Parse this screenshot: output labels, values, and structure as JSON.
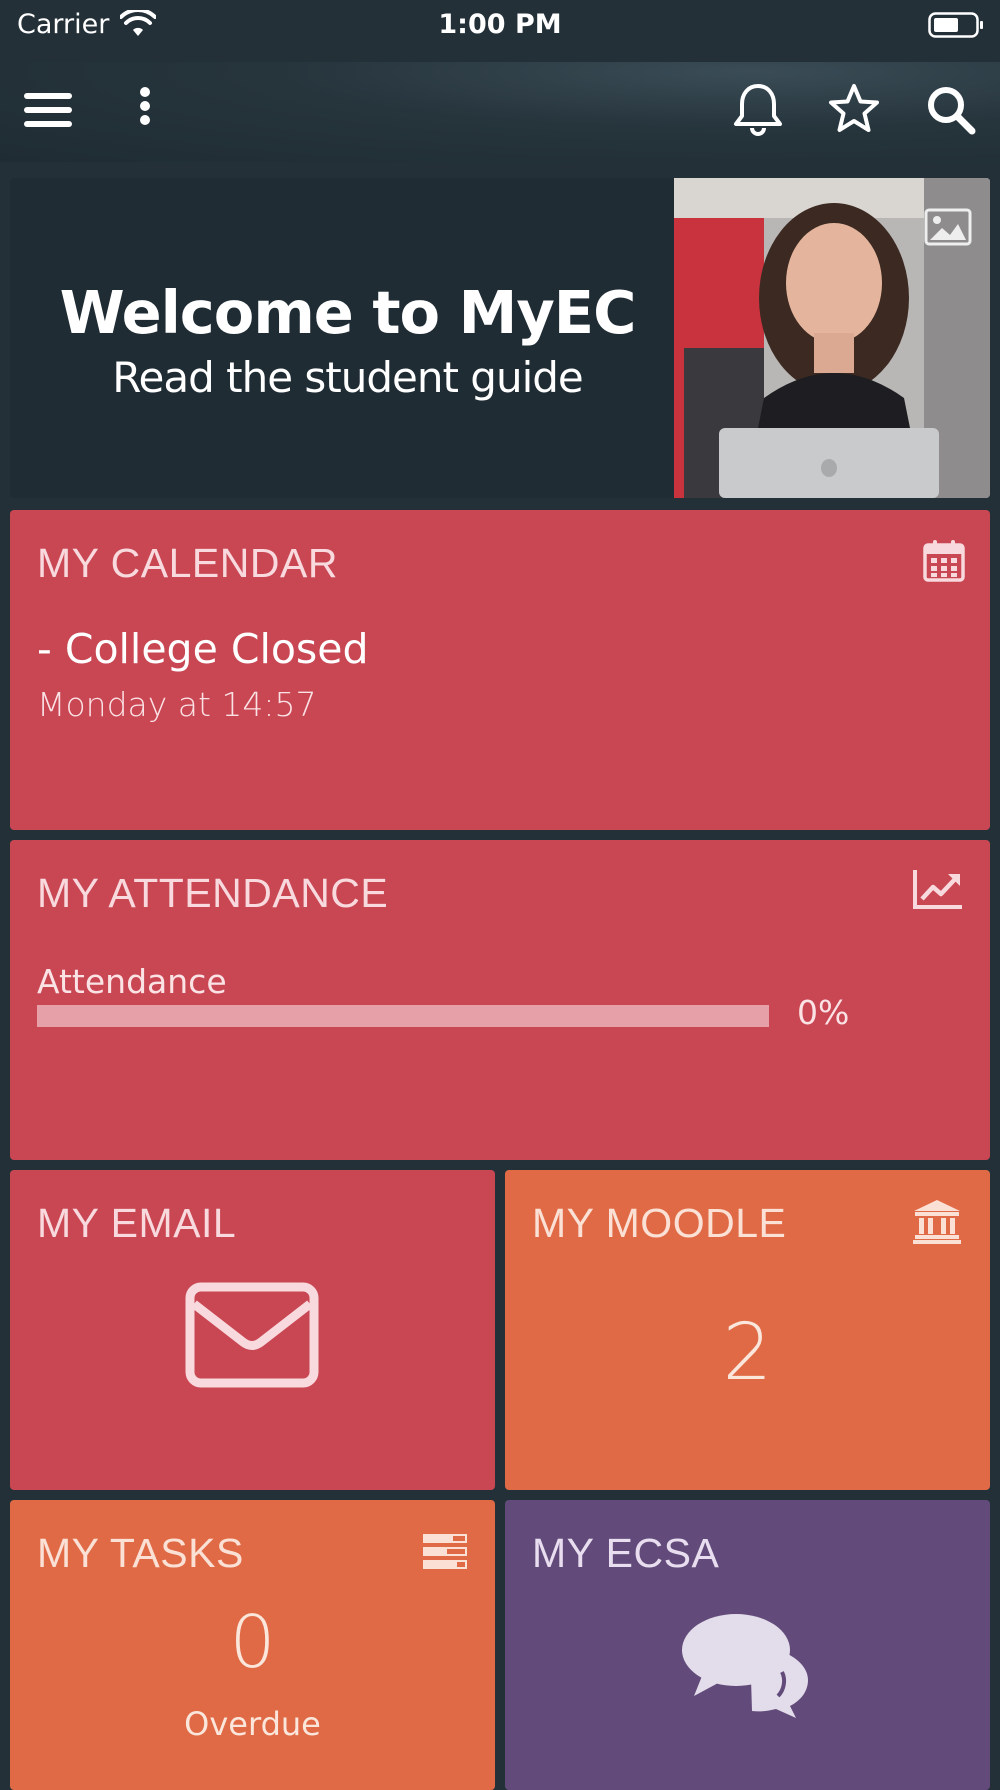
{
  "status_bar": {
    "carrier": "Carrier",
    "time": "1:00 PM"
  },
  "toolbar": {
    "icons": [
      "hamburger-menu-icon",
      "more-vertical-icon",
      "bell-icon",
      "star-icon",
      "search-icon"
    ]
  },
  "banner": {
    "headline": "Welcome to MyEC",
    "subtitle": "Read the student guide",
    "icon": "image-icon"
  },
  "calendar": {
    "title": "MY CALENDAR",
    "icon": "calendar-icon",
    "event_title": "- College Closed",
    "event_time": "Monday at 14:57"
  },
  "attendance": {
    "title": "MY ATTENDANCE",
    "icon": "line-chart-icon",
    "label": "Attendance",
    "percent_text": "0%",
    "percent_value": 0
  },
  "email": {
    "title": "MY EMAIL",
    "icon": "envelope-icon"
  },
  "moodle": {
    "title": "MY MOODLE",
    "icon": "institution-icon",
    "count": "2"
  },
  "tasks": {
    "title": "MY TASKS",
    "icon": "tasks-icon",
    "count": "0",
    "count_label": "Overdue"
  },
  "ecsa": {
    "title": "MY ECSA",
    "icon": "chat-bubbles-icon"
  },
  "colors": {
    "background": "#233038",
    "tile_red": "#c94653",
    "tile_orange": "#e06a45",
    "tile_purple": "#624b7a"
  }
}
